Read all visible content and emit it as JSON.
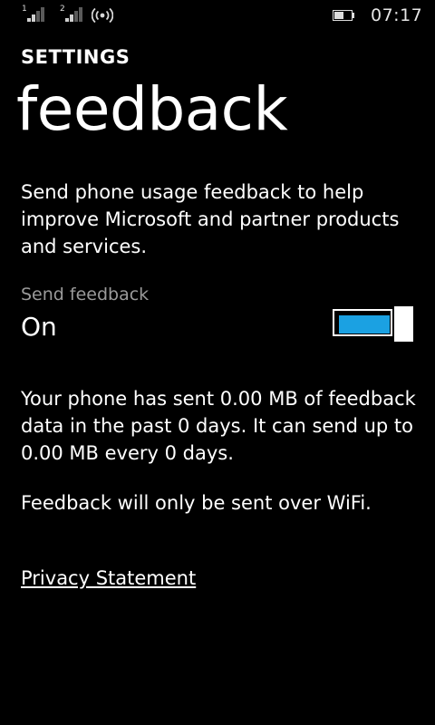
{
  "status_bar": {
    "sim1_label": "1",
    "sim2_label": "2",
    "time": "07:17",
    "icons": [
      "signal-sim1-icon",
      "signal-sim2-icon",
      "wifi-icon",
      "battery-icon"
    ]
  },
  "header": {
    "app_title": "SETTINGS",
    "page_title": "feedback"
  },
  "description": "Send phone usage feedback to help improve Microsoft and partner products and services.",
  "toggle": {
    "header": "Send feedback",
    "state": "On",
    "accent_color": "#1ba1e2"
  },
  "usage_text": "Your phone has sent 0.00 MB of feedback data in the past 0 days. It can send up to 0.00 MB every 0 days.",
  "wifi_note": "Feedback will only be sent over WiFi.",
  "privacy_link": "Privacy Statement"
}
